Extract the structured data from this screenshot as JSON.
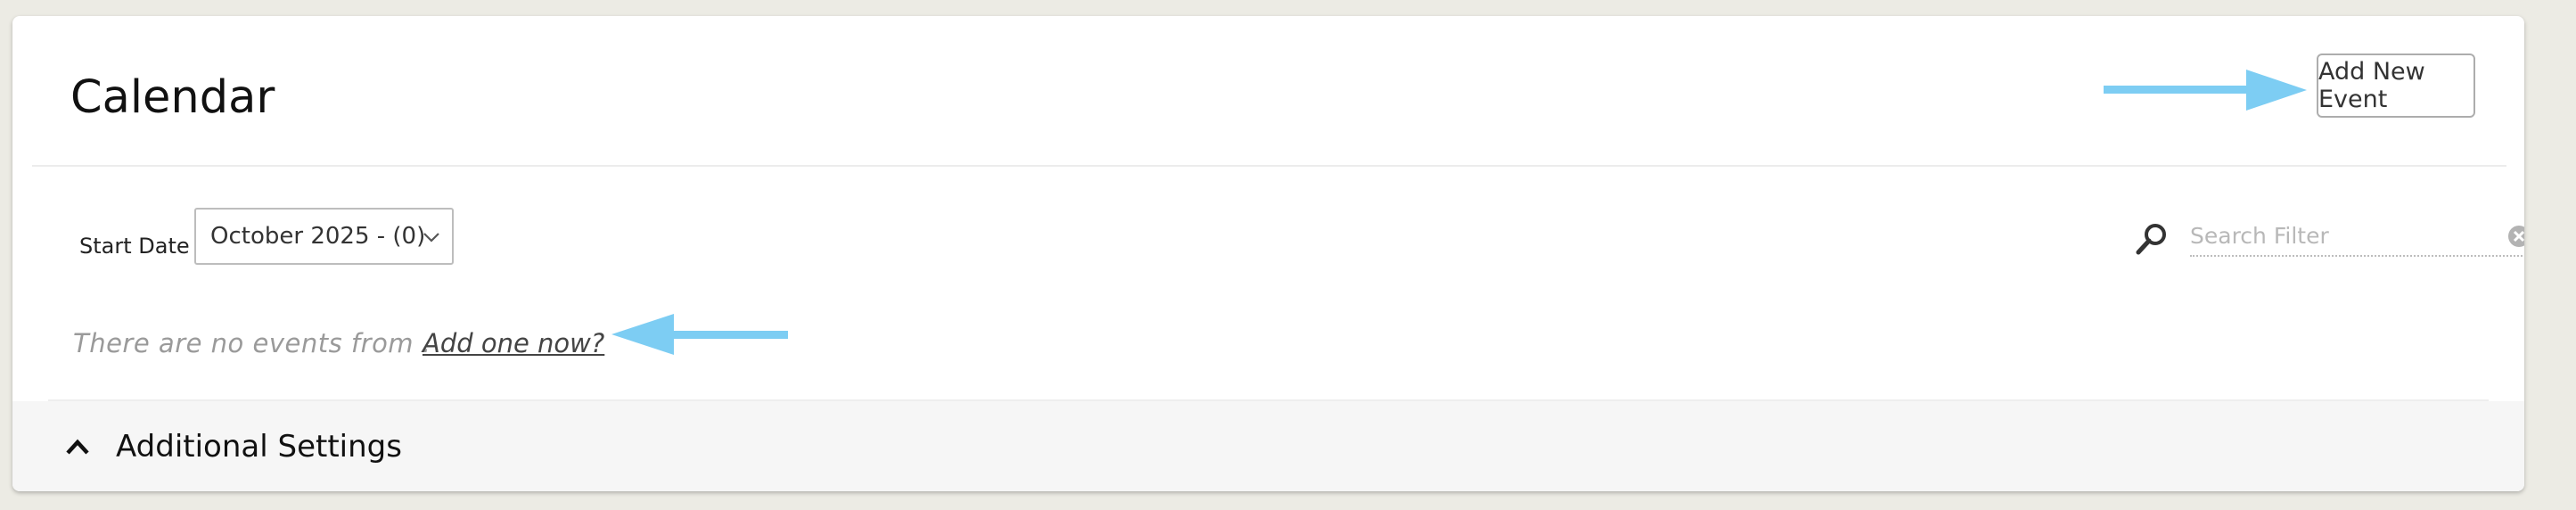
{
  "page": {
    "title": "Calendar"
  },
  "toolbar": {
    "add_event_label": "Add New Event"
  },
  "filters": {
    "start_date_label": "Start Date",
    "start_date_selected": "October 2025 - (0)",
    "search_placeholder": "Search Filter"
  },
  "events": {
    "empty_message": "There are no events from .",
    "add_link_label": "Add one now?"
  },
  "settings": {
    "label": "Additional Settings"
  },
  "icons": {
    "search": "search-icon",
    "clear": "clear-icon",
    "chevron_down": "chevron-down-icon",
    "chevron_up": "chevron-up-icon",
    "annotation_arrow": "arrow-icon"
  },
  "colors": {
    "annotation_arrow": "#7dcdf3",
    "page_background": "#ecebe4",
    "panel": "#ffffff"
  }
}
